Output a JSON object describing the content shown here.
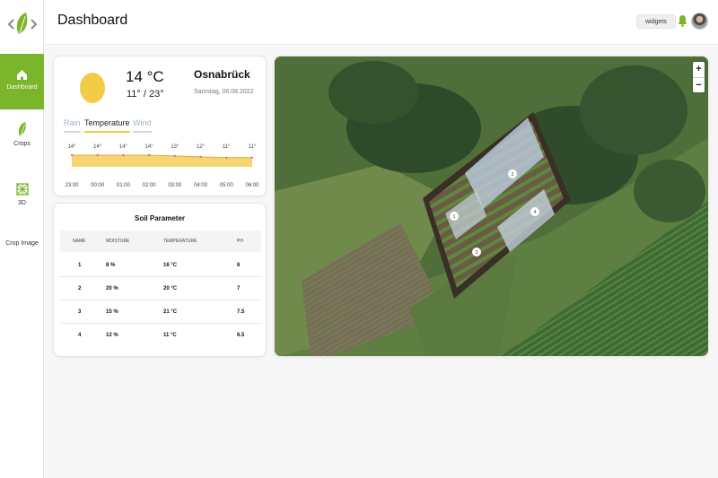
{
  "header": {
    "title": "Dashboard",
    "widgets_label": "widgets"
  },
  "sidebar": {
    "items": [
      {
        "label": "Dashboard",
        "icon": "home-icon",
        "active": true
      },
      {
        "label": "Crops",
        "icon": "leaf-icon",
        "active": false
      },
      {
        "label": "3D",
        "icon": "cube-3d-icon",
        "active": false
      },
      {
        "label": "Crop Image",
        "icon": "",
        "active": false
      }
    ]
  },
  "weather": {
    "temperature": "14 °C",
    "min_max": "11° / 23°",
    "city": "Osnabrück",
    "date": "Samstag, 06.08.2022",
    "tabs": [
      "Rain",
      "Temperature",
      "Wind"
    ],
    "active_tab": "Temperature",
    "chart_data": {
      "type": "area",
      "x": [
        "23:00",
        "00:00",
        "01:00",
        "02:00",
        "03:00",
        "04:00",
        "05:00",
        "06:00"
      ],
      "values": [
        14,
        14,
        14,
        14,
        13,
        12,
        11,
        11
      ],
      "value_labels": [
        "14°",
        "14°",
        "14°",
        "14°",
        "13°",
        "12°",
        "11°",
        "11°"
      ],
      "colors": {
        "fill": "#f3d572",
        "line": "#e8a93a",
        "marker": "#e06a8a"
      }
    }
  },
  "soil": {
    "title": "Soil Parameter",
    "columns": [
      "NAME",
      "MOISTURE",
      "TEMPERATURE",
      "PH"
    ],
    "rows": [
      [
        "1",
        "8 %",
        "16 °C",
        "6"
      ],
      [
        "2",
        "20 %",
        "20 °C",
        "7"
      ],
      [
        "3",
        "15 %",
        "21 °C",
        "7.5"
      ],
      [
        "4",
        "12 %",
        "11 °C",
        "6.5"
      ]
    ]
  },
  "map": {
    "zoom_in": "+",
    "zoom_out": "−",
    "markers": [
      "1",
      "2",
      "3",
      "4"
    ]
  },
  "colors": {
    "accent": "#7ab52b",
    "sun": "#f2cb47"
  }
}
